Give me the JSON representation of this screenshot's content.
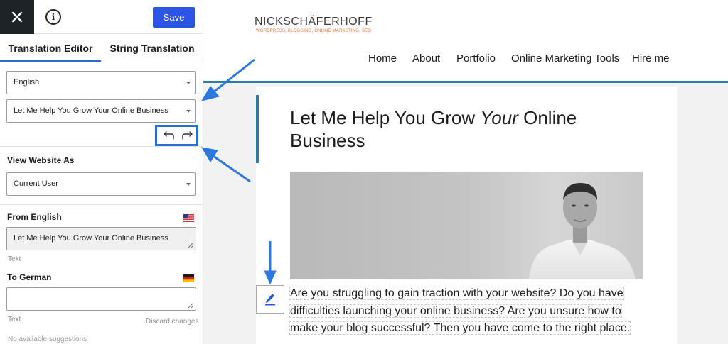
{
  "toolbar": {
    "save_label": "Save",
    "close_icon": "close-icon",
    "info_icon": "info-icon"
  },
  "tabs": [
    {
      "label": "Translation Editor",
      "active": true
    },
    {
      "label": "String Translation",
      "active": false
    }
  ],
  "language_select": {
    "value": "English"
  },
  "string_select": {
    "value": "Let Me Help You Grow Your Online Business"
  },
  "history": {
    "undo_icon": "undo-icon",
    "redo_icon": "redo-icon"
  },
  "view_as": {
    "title": "View Website As",
    "value": "Current User"
  },
  "from": {
    "title": "From English",
    "value": "Let Me Help You Grow Your Online Business",
    "type_label": "Text",
    "flag": "us-flag-icon"
  },
  "to": {
    "title": "To German",
    "value": "",
    "type_label": "Text",
    "discard_label": "Discard changes",
    "flag": "de-flag-icon"
  },
  "suggestions": "No available suggestions",
  "site": {
    "logo_name": "NICKSCHÄFERHOFF",
    "logo_tagline": "WORDPRESS, BLOGGING, ONLINE MARKETING, SEO",
    "nav": [
      "Home",
      "About",
      "Portfolio",
      "Online Marketing Tools",
      "Hire me"
    ],
    "title_before": "Let Me Help You Grow ",
    "title_emphasis": "Your",
    "title_after": " Online Business",
    "body_lines": [
      "Are you struggling to gain traction with your website? Do you have",
      "difficulties launching your online business? Are you unsure how to",
      "make your blog successful? Then you have come to the right place."
    ]
  },
  "colors": {
    "accent": "#2b6cd6",
    "save": "#2b55e6",
    "site_accent": "#2c7c9f",
    "logo_tag": "#e0783a"
  }
}
